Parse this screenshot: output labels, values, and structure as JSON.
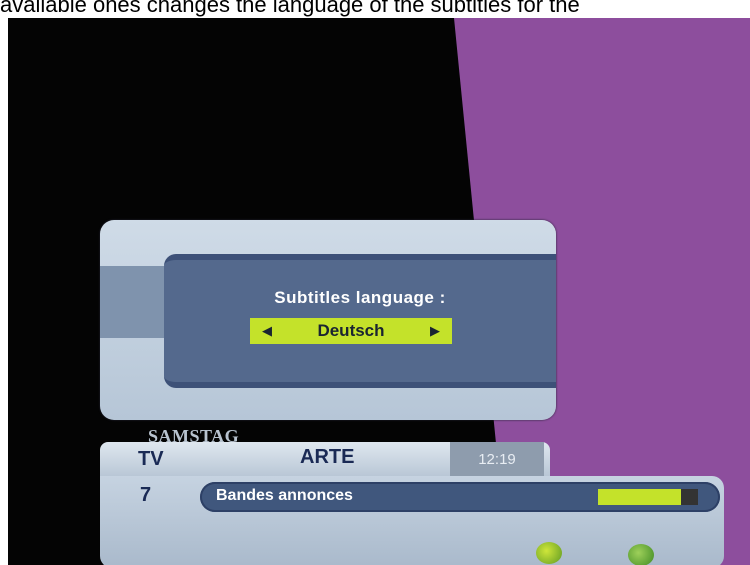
{
  "caption": {
    "text": "available ones changes the language of the subtitles for the"
  },
  "colors": {
    "background_left": "#040404",
    "background_right": "#8d4e9d",
    "accent_green": "#c4e22a",
    "panel_dark": "#54698d"
  },
  "subtitle_panel": {
    "title": "Subtitles language :",
    "value": "Deutsch",
    "left_arrow": "◀",
    "right_arrow": "▶"
  },
  "info_bar": {
    "day": "SAMSTAG",
    "tv_label": "TV",
    "channel_number": "7",
    "channel_name": "ARTE",
    "time": "12:19",
    "program": "Bandes annonces",
    "progress": 0.83,
    "icons": [
      "globe-icon",
      "subtitle-icon"
    ]
  }
}
